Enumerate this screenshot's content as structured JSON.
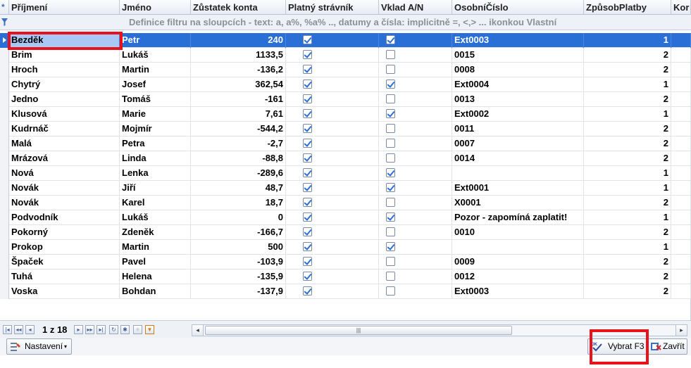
{
  "columns": [
    "Příjmení",
    "Jméno",
    "Zůstatek konta",
    "Platný strávník",
    "Vklad A/N",
    "OsobníČíslo",
    "ZpůsobPlatby",
    "Kor"
  ],
  "filter_hint": "Definice filtru na sloupcích - text: a, a%, %a% .., datumy a čísla: implicitně =, <,> ... ikonkou Vlastní",
  "rows": [
    {
      "prijmeni": "Bezděk",
      "jmeno": "Petr",
      "zustatek": "240",
      "platny": true,
      "vklad": true,
      "cislo": "Ext0003",
      "zpusob": "1"
    },
    {
      "prijmeni": "Brim",
      "jmeno": "Lukáš",
      "zustatek": "1133,5",
      "platny": true,
      "vklad": false,
      "cislo": "0015",
      "zpusob": "2"
    },
    {
      "prijmeni": "Hroch",
      "jmeno": "Martin",
      "zustatek": "-136,2",
      "platny": true,
      "vklad": false,
      "cislo": "0008",
      "zpusob": "2"
    },
    {
      "prijmeni": "Chytrý",
      "jmeno": "Josef",
      "zustatek": "362,54",
      "platny": true,
      "vklad": true,
      "cislo": "Ext0004",
      "zpusob": "1"
    },
    {
      "prijmeni": "Jedno",
      "jmeno": "Tomáš",
      "zustatek": "-161",
      "platny": true,
      "vklad": false,
      "cislo": "0013",
      "zpusob": "2"
    },
    {
      "prijmeni": "Klusová",
      "jmeno": "Marie",
      "zustatek": "7,61",
      "platny": true,
      "vklad": true,
      "cislo": "Ext0002",
      "zpusob": "1"
    },
    {
      "prijmeni": "Kudrnáč",
      "jmeno": "Mojmír",
      "zustatek": "-544,2",
      "platny": true,
      "vklad": false,
      "cislo": "0011",
      "zpusob": "2"
    },
    {
      "prijmeni": "Malá",
      "jmeno": "Petra",
      "zustatek": "-2,7",
      "platny": true,
      "vklad": false,
      "cislo": "0007",
      "zpusob": "2"
    },
    {
      "prijmeni": "Mrázová",
      "jmeno": "Linda",
      "zustatek": "-88,8",
      "platny": true,
      "vklad": false,
      "cislo": "0014",
      "zpusob": "2"
    },
    {
      "prijmeni": "Nová",
      "jmeno": "Lenka",
      "zustatek": "-289,6",
      "platny": true,
      "vklad": true,
      "cislo": "",
      "zpusob": "1"
    },
    {
      "prijmeni": "Novák",
      "jmeno": "Jiří",
      "zustatek": "48,7",
      "platny": true,
      "vklad": true,
      "cislo": "Ext0001",
      "zpusob": "1"
    },
    {
      "prijmeni": "Novák",
      "jmeno": "Karel",
      "zustatek": "18,7",
      "platny": true,
      "vklad": false,
      "cislo": "X0001",
      "zpusob": "2"
    },
    {
      "prijmeni": "Podvodník",
      "jmeno": "Lukáš",
      "zustatek": "0",
      "platny": true,
      "vklad": true,
      "cislo": "Pozor - zapomíná zaplatit!",
      "zpusob": "1"
    },
    {
      "prijmeni": "Pokorný",
      "jmeno": "Zdeněk",
      "zustatek": "-166,7",
      "platny": true,
      "vklad": false,
      "cislo": "0010",
      "zpusob": "2"
    },
    {
      "prijmeni": "Prokop",
      "jmeno": "Martin",
      "zustatek": "500",
      "platny": true,
      "vklad": true,
      "cislo": "",
      "zpusob": "1"
    },
    {
      "prijmeni": "Špaček",
      "jmeno": "Pavel",
      "zustatek": "-103,9",
      "platny": true,
      "vklad": false,
      "cislo": "0009",
      "zpusob": "2"
    },
    {
      "prijmeni": "Tuhá",
      "jmeno": "Helena",
      "zustatek": "-135,9",
      "platny": true,
      "vklad": false,
      "cislo": "0012",
      "zpusob": "2"
    },
    {
      "prijmeni": "Voska",
      "jmeno": "Bohdan",
      "zustatek": "-137,9",
      "platny": true,
      "vklad": false,
      "cislo": "Ext0003",
      "zpusob": "2"
    }
  ],
  "selected_row": 0,
  "pager": {
    "text": "1 z 18"
  },
  "toolbar": {
    "settings_label": "Nastavení",
    "select_label": "Vybrat F3",
    "close_label": "Zavřít"
  },
  "colors": {
    "selection": "#2a6fd6",
    "highlight": "#e8121c"
  }
}
